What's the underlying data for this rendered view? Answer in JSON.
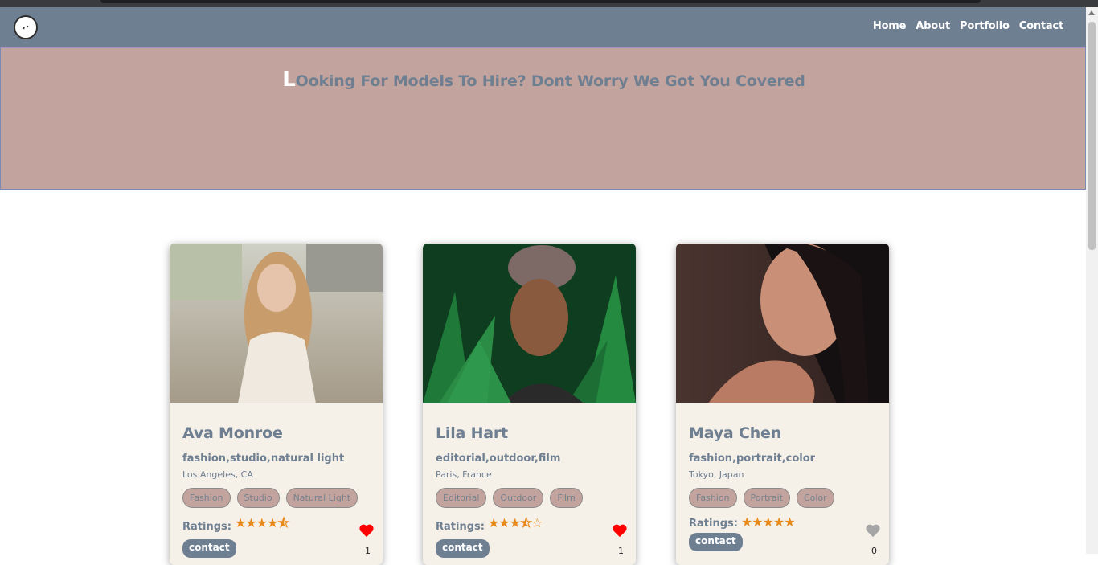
{
  "nav": {
    "items": [
      "Home",
      "About",
      "Portfolio",
      "Contact"
    ]
  },
  "hero": {
    "first_letter": "L",
    "rest": "Ooking For Models To Hire? Dont Worry We Got You Covered"
  },
  "labels": {
    "ratings": "Ratings:",
    "contact": "contact"
  },
  "cards": [
    {
      "name": "Ava Monroe",
      "tags": "fashion,studio,natural light",
      "location": "Los Angeles, CA",
      "chips": [
        "Fashion",
        "Studio",
        "Natural Light"
      ],
      "rating_stars": "★★★★⯪",
      "rating": 4.5,
      "liked": true,
      "likes": "1",
      "heart_color": "#ff0000"
    },
    {
      "name": "Lila Hart",
      "tags": "editorial,outdoor,film",
      "location": "Paris, France",
      "chips": [
        "Editorial",
        "Outdoor",
        "Film"
      ],
      "rating_stars": "★★★⯪☆",
      "rating": 3.5,
      "liked": true,
      "likes": "1",
      "heart_color": "#ff0000"
    },
    {
      "name": "Maya Chen",
      "tags": "fashion,portrait,color",
      "location": "Tokyo, Japan",
      "chips": [
        "Fashion",
        "Portrait",
        "Color"
      ],
      "rating_stars": "★★★★★",
      "rating": 5,
      "liked": false,
      "likes": "0",
      "heart_color": "#a6a6a6"
    }
  ]
}
